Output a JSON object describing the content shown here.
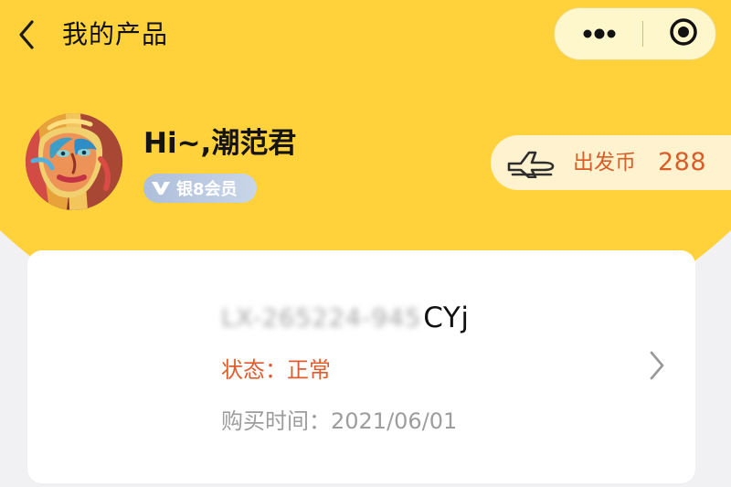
{
  "header": {
    "title": "我的产品",
    "back_icon": "chevron-left-icon",
    "more_icon": "more-horizontal-icon",
    "close_icon": "target-close-icon"
  },
  "profile": {
    "greeting": "Hi~,潮范君",
    "avatar_icon": "user-avatar-art",
    "member_level": "银8会员",
    "member_badge_icon": "vip-v-icon"
  },
  "rewards": {
    "label": "出发币",
    "value": "288",
    "icon": "airplane-icon"
  },
  "product": {
    "serial_masked": "LX-265224-945",
    "serial_visible": "CYj",
    "status": "状态：正常",
    "purchase_time": "购买时间：2021/06/01",
    "arrow_icon": "chevron-right-icon"
  },
  "colors": {
    "brand_yellow": "#ffd13b",
    "accent_orange": "#d85d29",
    "card_white": "#ffffff",
    "member_blue": "#aebfdb"
  }
}
